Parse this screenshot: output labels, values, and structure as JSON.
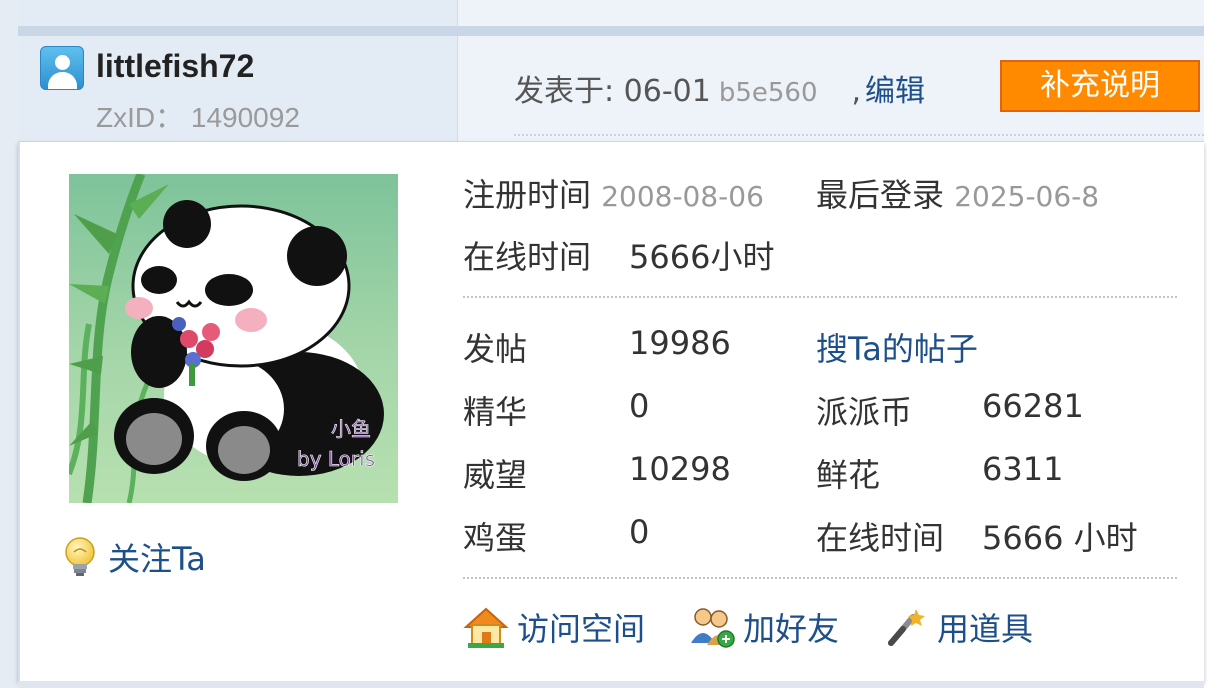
{
  "author": {
    "username": "littlefish72",
    "zxid": "ZxID： 1490092"
  },
  "post": {
    "posted_label": "发表于: 06-01",
    "ip": "b5e560",
    "comma": ",",
    "edit_label": "编辑",
    "supplement_label": "补充说明"
  },
  "avatar_caption": {
    "line1": "小鱼",
    "line2": "by Loris"
  },
  "profile": {
    "register_label": "注册时间",
    "register_value": "2008-08-06",
    "last_login_label": "最后登录",
    "last_login_value": "2025-06-8",
    "online_label": "在线时间",
    "online_value": "5666小时",
    "follow_label": "关注Ta"
  },
  "stats": {
    "posts_label": "发帖",
    "posts_value": "19986",
    "search_link": "搜Ta的帖子",
    "digest_label": "精华",
    "digest_value": "0",
    "coins_label": "派派币",
    "coins_value": "66281",
    "prestige_label": "威望",
    "prestige_value": "10298",
    "flowers_label": "鲜花",
    "flowers_value": "6311",
    "eggs_label": "鸡蛋",
    "eggs_value": "0",
    "online2_label": "在线时间",
    "online2_value": "5666 小时"
  },
  "actions": {
    "visit_space": "访问空间",
    "add_friend": "加好友",
    "use_item": "用道具"
  },
  "icons": {
    "avatar_small": "user-avatar-icon",
    "follow": "lightbulb-icon",
    "visit_space": "home-icon",
    "add_friend": "add-friend-icon",
    "use_item": "magic-wand-icon"
  },
  "colors": {
    "link": "#1d4f8a",
    "accent_button": "#ff8a00",
    "header_bg": "#e3ebf4"
  }
}
